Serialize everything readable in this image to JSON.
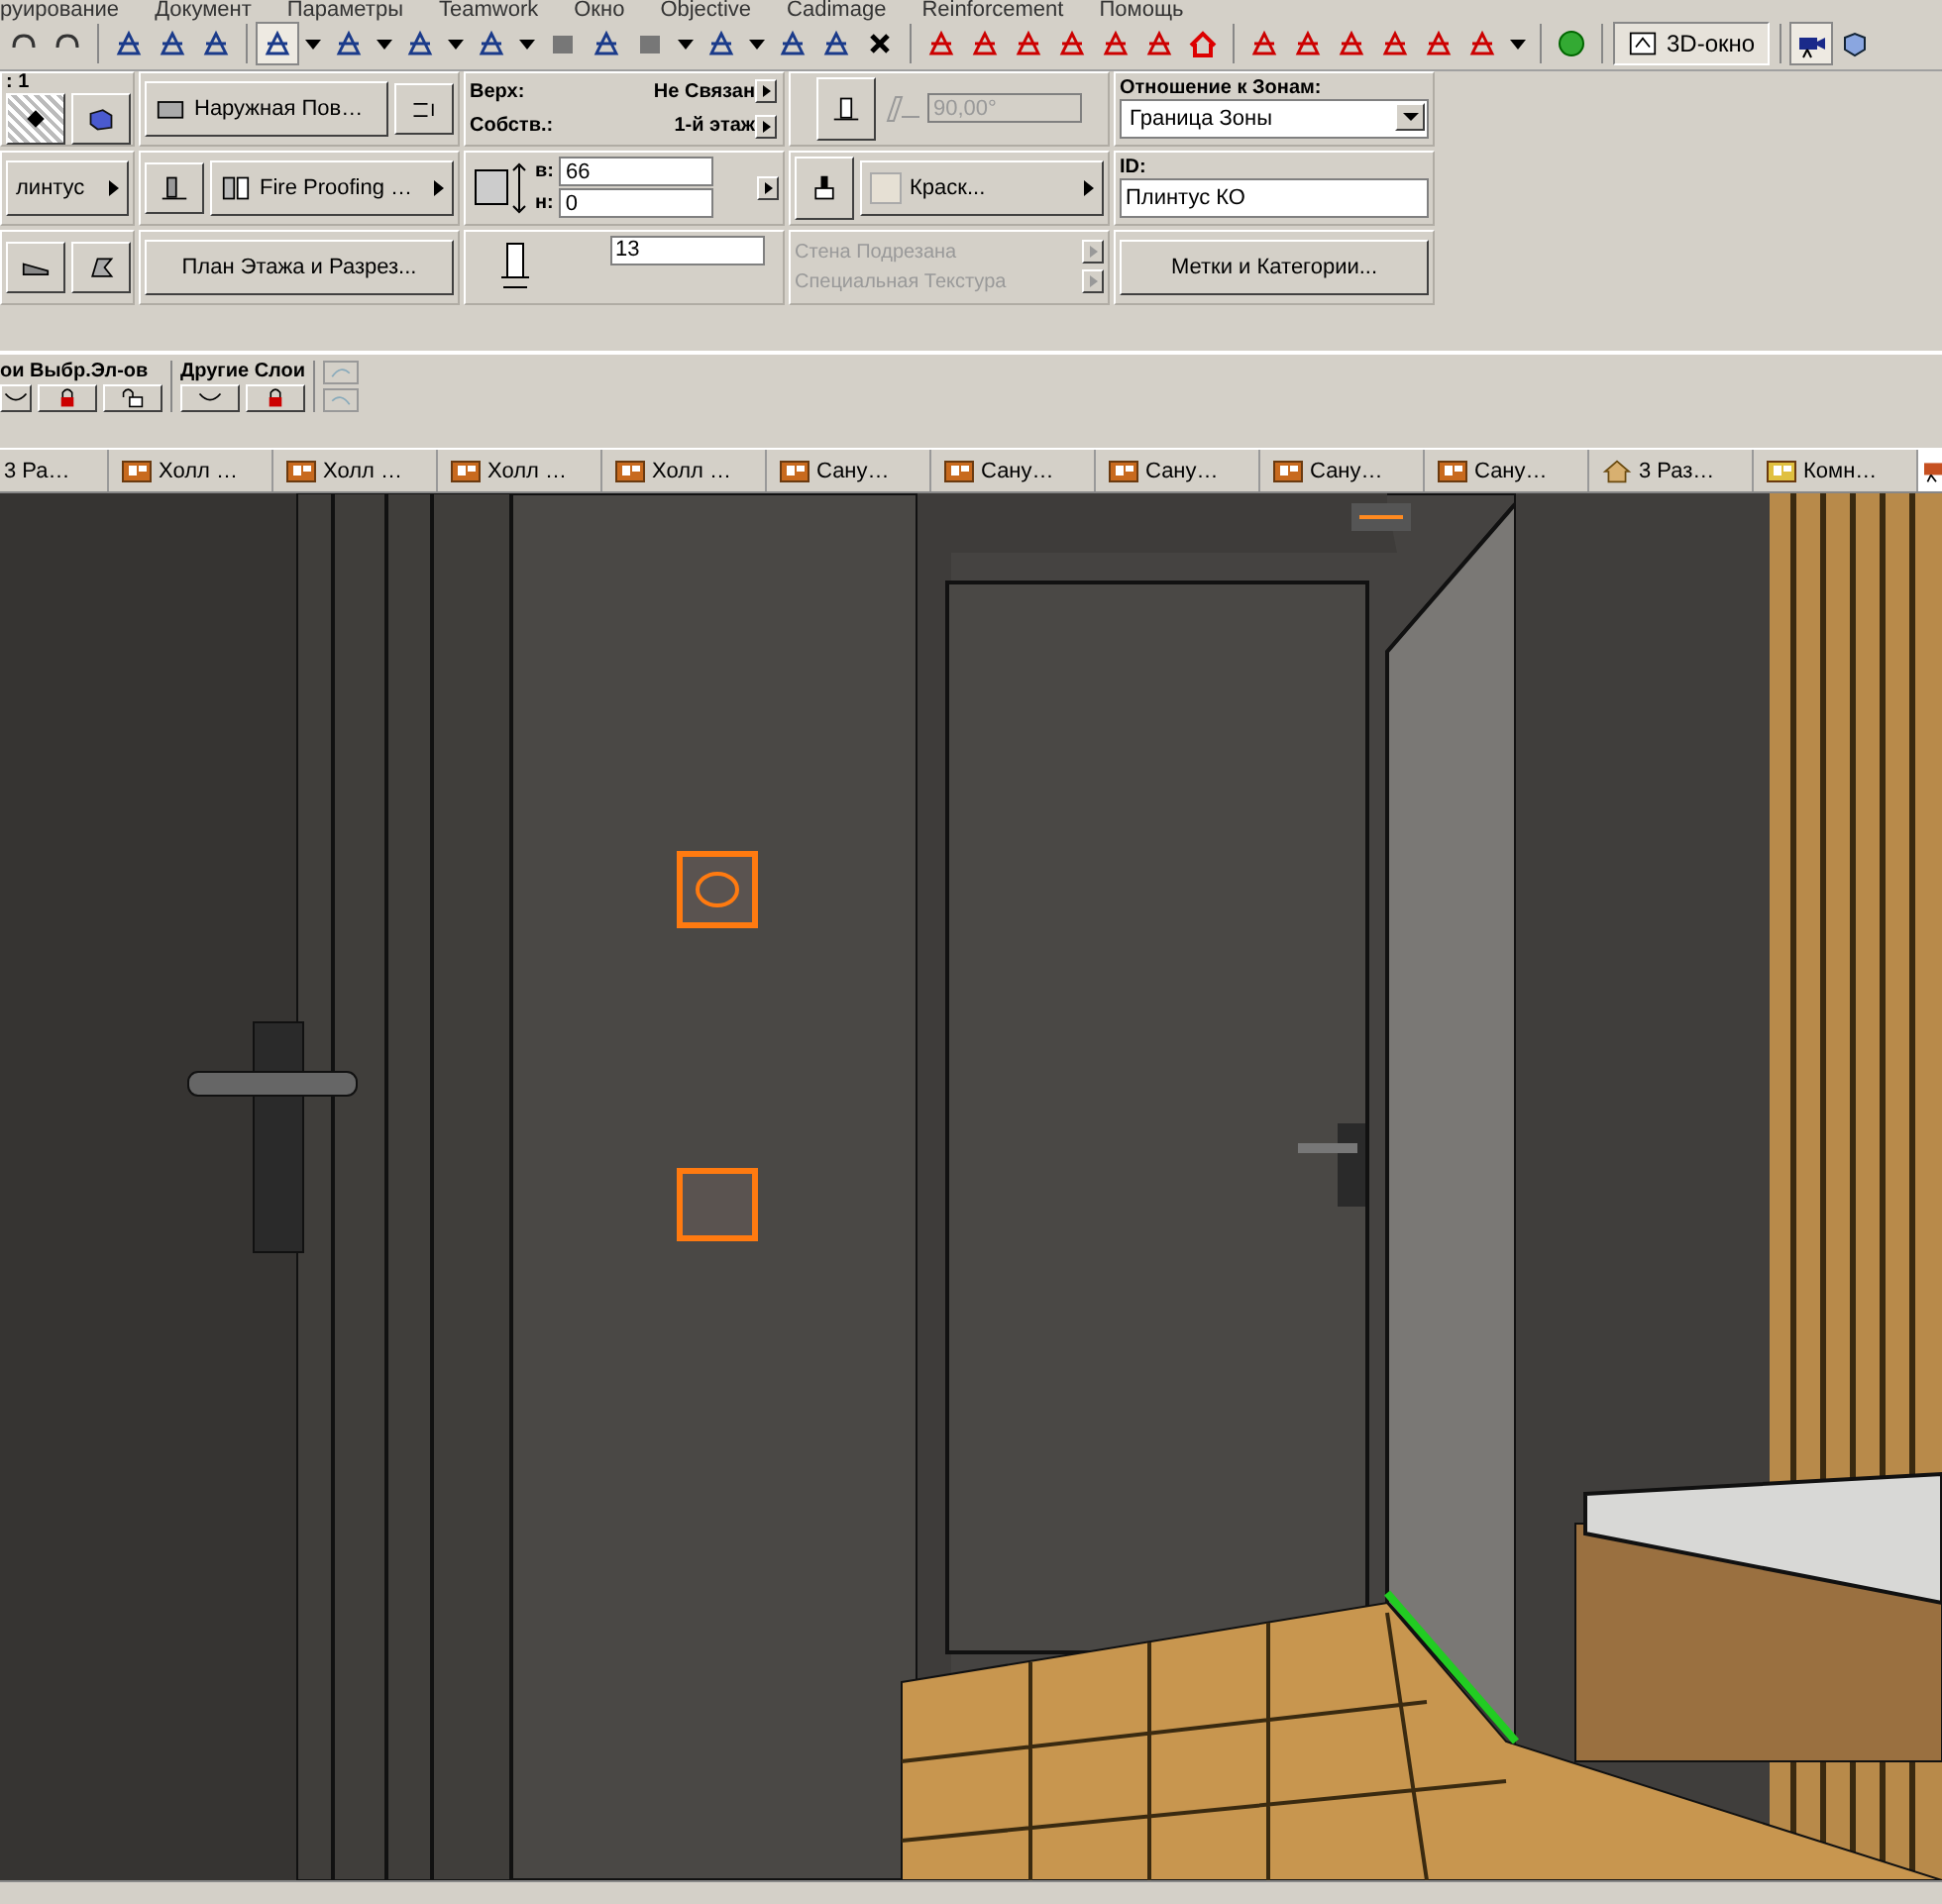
{
  "menu": [
    "руирование",
    "Документ",
    "Параметры",
    "Teamwork",
    "Окно",
    "Objective",
    "Cadimage",
    "Reinforcement",
    "Помощь"
  ],
  "toolbar": {
    "window_button": "3D-окно",
    "window_button_selected": true
  },
  "info_box": {
    "scale_label": ": 1",
    "profile_button": "линтус",
    "surface_button": "Наружная Пов…",
    "building_material_button": "Fire Proofing …",
    "floorplan_button": "План Этажа и Разрез...",
    "top_label": "Верх:",
    "top_value": "Не Связан",
    "home_label": "Собств.:",
    "home_value": "1-й этаж",
    "height_label": "в:",
    "height_value": "66",
    "offset_label": "н:",
    "offset_value": "0",
    "thickness_value": "13",
    "angle_value": "90,00°",
    "angle_disabled": true,
    "paint_button": "Краск...",
    "options": [
      {
        "label": "Стена Подрезана",
        "disabled": true
      },
      {
        "label": "Специальная Текстура",
        "disabled": true
      }
    ],
    "zone_label": "Отношение к Зонам:",
    "zone_value": "Граница Зоны",
    "id_label": "ID:",
    "id_value": "Плинтус КО",
    "tags_button": "Метки и Категории..."
  },
  "layers": {
    "selected_group": "ои Выбр.Эл-ов",
    "other_group": "Другие Слои"
  },
  "tabs": [
    {
      "label": "3 Ра…",
      "kind": "section",
      "selected": false
    },
    {
      "label": "Холл …",
      "kind": "room",
      "selected": false
    },
    {
      "label": "Холл …",
      "kind": "room",
      "selected": false
    },
    {
      "label": "Холл …",
      "kind": "room",
      "selected": false
    },
    {
      "label": "Холл …",
      "kind": "room",
      "selected": false
    },
    {
      "label": "Сану…",
      "kind": "room",
      "selected": false
    },
    {
      "label": "Сану…",
      "kind": "room",
      "selected": false
    },
    {
      "label": "Сану…",
      "kind": "room",
      "selected": false
    },
    {
      "label": "Сану…",
      "kind": "room",
      "selected": false
    },
    {
      "label": "Сану…",
      "kind": "room",
      "selected": false
    },
    {
      "label": "3 Раз…",
      "kind": "house",
      "selected": false
    },
    {
      "label": "Комн…",
      "kind": "plan",
      "selected": false
    },
    {
      "kind": "camera",
      "selected": true
    }
  ]
}
